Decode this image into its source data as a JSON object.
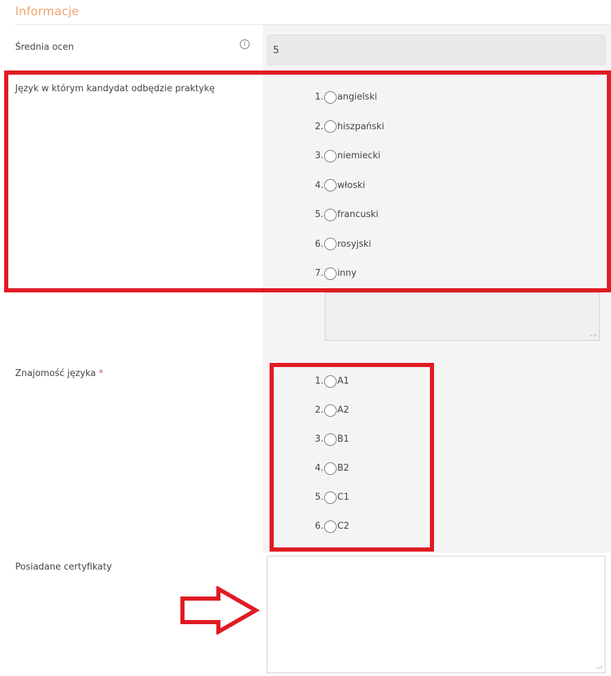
{
  "section": {
    "title": "Informacje"
  },
  "average": {
    "label": "Średnia ocen",
    "info_icon": "i",
    "value": "5"
  },
  "language": {
    "label": "Język w którym kandydat odbędzie praktykę",
    "options": [
      {
        "num": "1.",
        "label": "angielski"
      },
      {
        "num": "2.",
        "label": "hiszpański"
      },
      {
        "num": "3.",
        "label": "niemiecki"
      },
      {
        "num": "4.",
        "label": "włoski"
      },
      {
        "num": "5.",
        "label": "francuski"
      },
      {
        "num": "6.",
        "label": "rosyjski"
      },
      {
        "num": "7.",
        "label": "inny"
      }
    ],
    "other_value": ""
  },
  "proficiency": {
    "label": "Znajomość języka",
    "required_mark": "*",
    "options": [
      {
        "num": "1.",
        "label": "A1"
      },
      {
        "num": "2.",
        "label": "A2"
      },
      {
        "num": "3.",
        "label": "B1"
      },
      {
        "num": "4.",
        "label": "B2"
      },
      {
        "num": "5.",
        "label": "C1"
      },
      {
        "num": "6.",
        "label": "C2"
      }
    ]
  },
  "certificates": {
    "label": "Posiadane certyfikaty",
    "value": ""
  },
  "annotation_colors": {
    "highlight": "#e01b24",
    "section_title": "#f0a46e"
  }
}
